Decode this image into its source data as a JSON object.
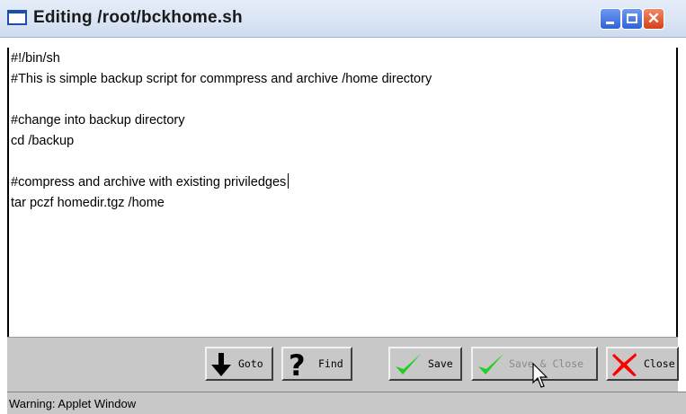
{
  "window": {
    "title": "Editing /root/bckhome.sh",
    "controls": {
      "minimize": "minimize-icon",
      "maximize": "maximize-icon",
      "close": "close-icon"
    }
  },
  "editor": {
    "lines": [
      "#!/bin/sh",
      "#This is simple backup script for commpress and archive /home directory",
      "",
      "#change into backup directory",
      "cd /backup",
      "",
      "#compress and archive with existing priviledges",
      "tar pczf homedir.tgz /home"
    ]
  },
  "toolbar": {
    "goto_label": "Goto",
    "find_label": "Find",
    "save_label": "Save",
    "save_close_label": "Save & Close",
    "close_label": "Close"
  },
  "status": {
    "text": "Warning: Applet Window"
  },
  "icons": {
    "goto": "down-arrow-icon",
    "find": "question-mark-icon",
    "save": "checkmark-icon",
    "save_close": "checkmark-icon",
    "close": "red-x-icon"
  },
  "colors": {
    "check": "#1fcf1f",
    "close_x": "#ff0000",
    "title_bar": "#dce6f5"
  }
}
